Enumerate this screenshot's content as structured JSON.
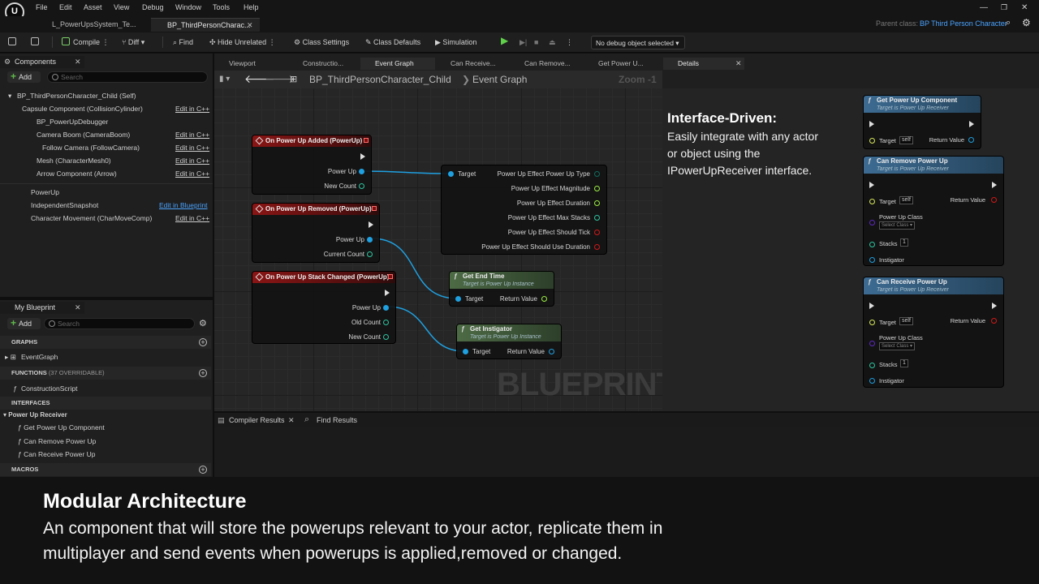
{
  "menu": [
    "File",
    "Edit",
    "Asset",
    "View",
    "Debug",
    "Window",
    "Tools",
    "Help"
  ],
  "tabs": {
    "level": "L_PowerUpsSystem_Te...",
    "blueprint": "BP_ThirdPersonCharac..."
  },
  "parent_class": {
    "label": "Parent class:",
    "value": "BP Third Person Character"
  },
  "toolbar": {
    "compile": "Compile",
    "diff": "Diff",
    "find": "Find",
    "hide_unrelated": "Hide Unrelated",
    "class_settings": "Class Settings",
    "class_defaults": "Class Defaults",
    "simulation": "Simulation",
    "debug_object": "No debug object selected"
  },
  "components": {
    "title": "Components",
    "add": "Add",
    "search_placeholder": "Search",
    "items": [
      {
        "label": "BP_ThirdPersonCharacter_Child (Self)",
        "edit": ""
      },
      {
        "label": "Capsule Component (CollisionCylinder)",
        "edit": "Edit in C++"
      },
      {
        "label": "BP_PowerUpDebugger",
        "edit": ""
      },
      {
        "label": "Camera Boom (CameraBoom)",
        "edit": "Edit in C++"
      },
      {
        "label": "Follow Camera (FollowCamera)",
        "edit": "Edit in C++"
      },
      {
        "label": "Mesh (CharacterMesh0)",
        "edit": "Edit in C++"
      },
      {
        "label": "Arrow Component (Arrow)",
        "edit": "Edit in C++"
      },
      {
        "label": "PowerUp",
        "edit": ""
      },
      {
        "label": "IndependentSnapshot",
        "edit": "Edit in Blueprint"
      },
      {
        "label": "Character Movement (CharMoveComp)",
        "edit": "Edit in C++"
      }
    ]
  },
  "my_blueprint": {
    "title": "My Blueprint",
    "add": "Add",
    "search_placeholder": "Search",
    "graphs_label": "GRAPHS",
    "event_graph": "EventGraph",
    "functions_label": "FUNCTIONS",
    "functions_count": "(37 OVERRIDABLE)",
    "construction_script": "ConstructionScript",
    "interfaces_label": "INTERFACES",
    "interface_name": "Power Up Receiver",
    "interface_functions": [
      "Get Power Up Component",
      "Can Remove Power Up",
      "Can Receive Power Up"
    ],
    "macros_label": "MACROS"
  },
  "graph_tabs": [
    "Viewport",
    "Constructio...",
    "Event Graph",
    "Can Receive...",
    "Can Remove...",
    "Get Power U..."
  ],
  "breadcrumb": {
    "class": "BP_ThirdPersonCharacter_Child",
    "graph": "Event Graph",
    "zoom": "Zoom -1"
  },
  "nodes": {
    "added": {
      "title": "On Power Up Added (PowerUp)",
      "pins": [
        "Power Up",
        "New Count"
      ]
    },
    "removed": {
      "title": "On Power Up Removed (PowerUp)",
      "pins": [
        "Power Up",
        "Current Count"
      ]
    },
    "stack": {
      "title": "On Power Up Stack Changed (PowerUp)",
      "pins": [
        "Power Up",
        "Old Count",
        "New Count"
      ]
    },
    "break": {
      "target": "Target",
      "outputs": [
        "Power Up Effect Power Up Type",
        "Power Up Effect Magnitude",
        "Power Up Effect Duration",
        "Power Up Effect Max Stacks",
        "Power Up Effect Should Tick",
        "Power Up Effect Should Use Duration"
      ]
    },
    "end_time": {
      "title": "Get End Time",
      "sub": "Target is Power Up Instance",
      "target": "Target",
      "ret": "Return Value"
    },
    "instigator": {
      "title": "Get Instigator",
      "sub": "Target is Power Up Instance",
      "target": "Target",
      "ret": "Return Value"
    }
  },
  "watermark": "BLUEPRINT",
  "details": {
    "title": "Details",
    "heading": "Interface-Driven:",
    "lines": [
      "Easily integrate with any actor",
      "or object using the",
      "IPowerUpReceiver interface."
    ],
    "cards": [
      {
        "title": "Get Power Up Component",
        "sub": "Target is Power Up Receiver",
        "target": "Target",
        "self": "self",
        "ret": "Return Value"
      },
      {
        "title": "Can Remove Power Up",
        "sub": "Target is Power Up Receiver",
        "target": "Target",
        "self": "self",
        "ret": "Return Value",
        "pu_class": "Power Up Class",
        "select": "Select Class",
        "stacks": "Stacks",
        "stacks_val": "1",
        "instigator": "Instigator"
      },
      {
        "title": "Can Receive Power Up",
        "sub": "Target is Power Up Receiver",
        "target": "Target",
        "self": "self",
        "ret": "Return Value",
        "pu_class": "Power Up Class",
        "select": "Select Class",
        "stacks": "Stacks",
        "stacks_val": "1",
        "instigator": "Instigator"
      }
    ]
  },
  "bottom_tabs": [
    "Compiler Results",
    "Find Results"
  ],
  "caption": {
    "title": "Modular Architecture",
    "line1": "An component that will store the powerups relevant to your actor, replicate them in",
    "line2": "multiplayer and send events when powerups is applied,removed or changed."
  },
  "colors": {
    "exec": "#dddddd",
    "object_pin": "#1fa0e0",
    "int_pin": "#2ec7a0",
    "float_pin": "#9bf043",
    "bool_pin": "#d31818",
    "enum_pin": "#0f6d5f",
    "class_pin": "#5d2abf",
    "accent_link": "#4aa3ff"
  }
}
